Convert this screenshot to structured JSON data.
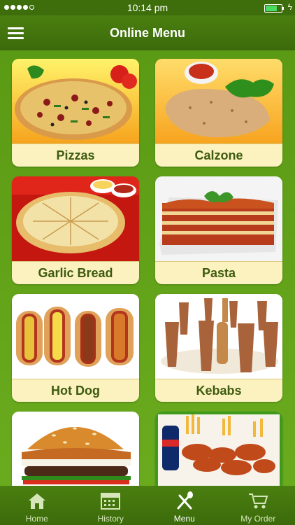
{
  "status": {
    "time": "10:14 pm"
  },
  "header": {
    "title": "Online Menu"
  },
  "menu": {
    "items": [
      {
        "label": "Pizzas"
      },
      {
        "label": "Calzone"
      },
      {
        "label": "Garlic Bread"
      },
      {
        "label": "Pasta"
      },
      {
        "label": "Hot Dog"
      },
      {
        "label": "Kebabs"
      },
      {
        "label": ""
      },
      {
        "label": ""
      }
    ]
  },
  "tabs": [
    {
      "label": "Home",
      "icon": "home-icon"
    },
    {
      "label": "History",
      "icon": "calendar-icon"
    },
    {
      "label": "Menu",
      "icon": "utensils-icon",
      "active": true
    },
    {
      "label": "My Order",
      "icon": "cart-icon"
    }
  ],
  "colors": {
    "background": "#5b9a14",
    "bar": "#3e6e0c",
    "card": "#fbf2c0",
    "label_text": "#3d5a0e"
  }
}
